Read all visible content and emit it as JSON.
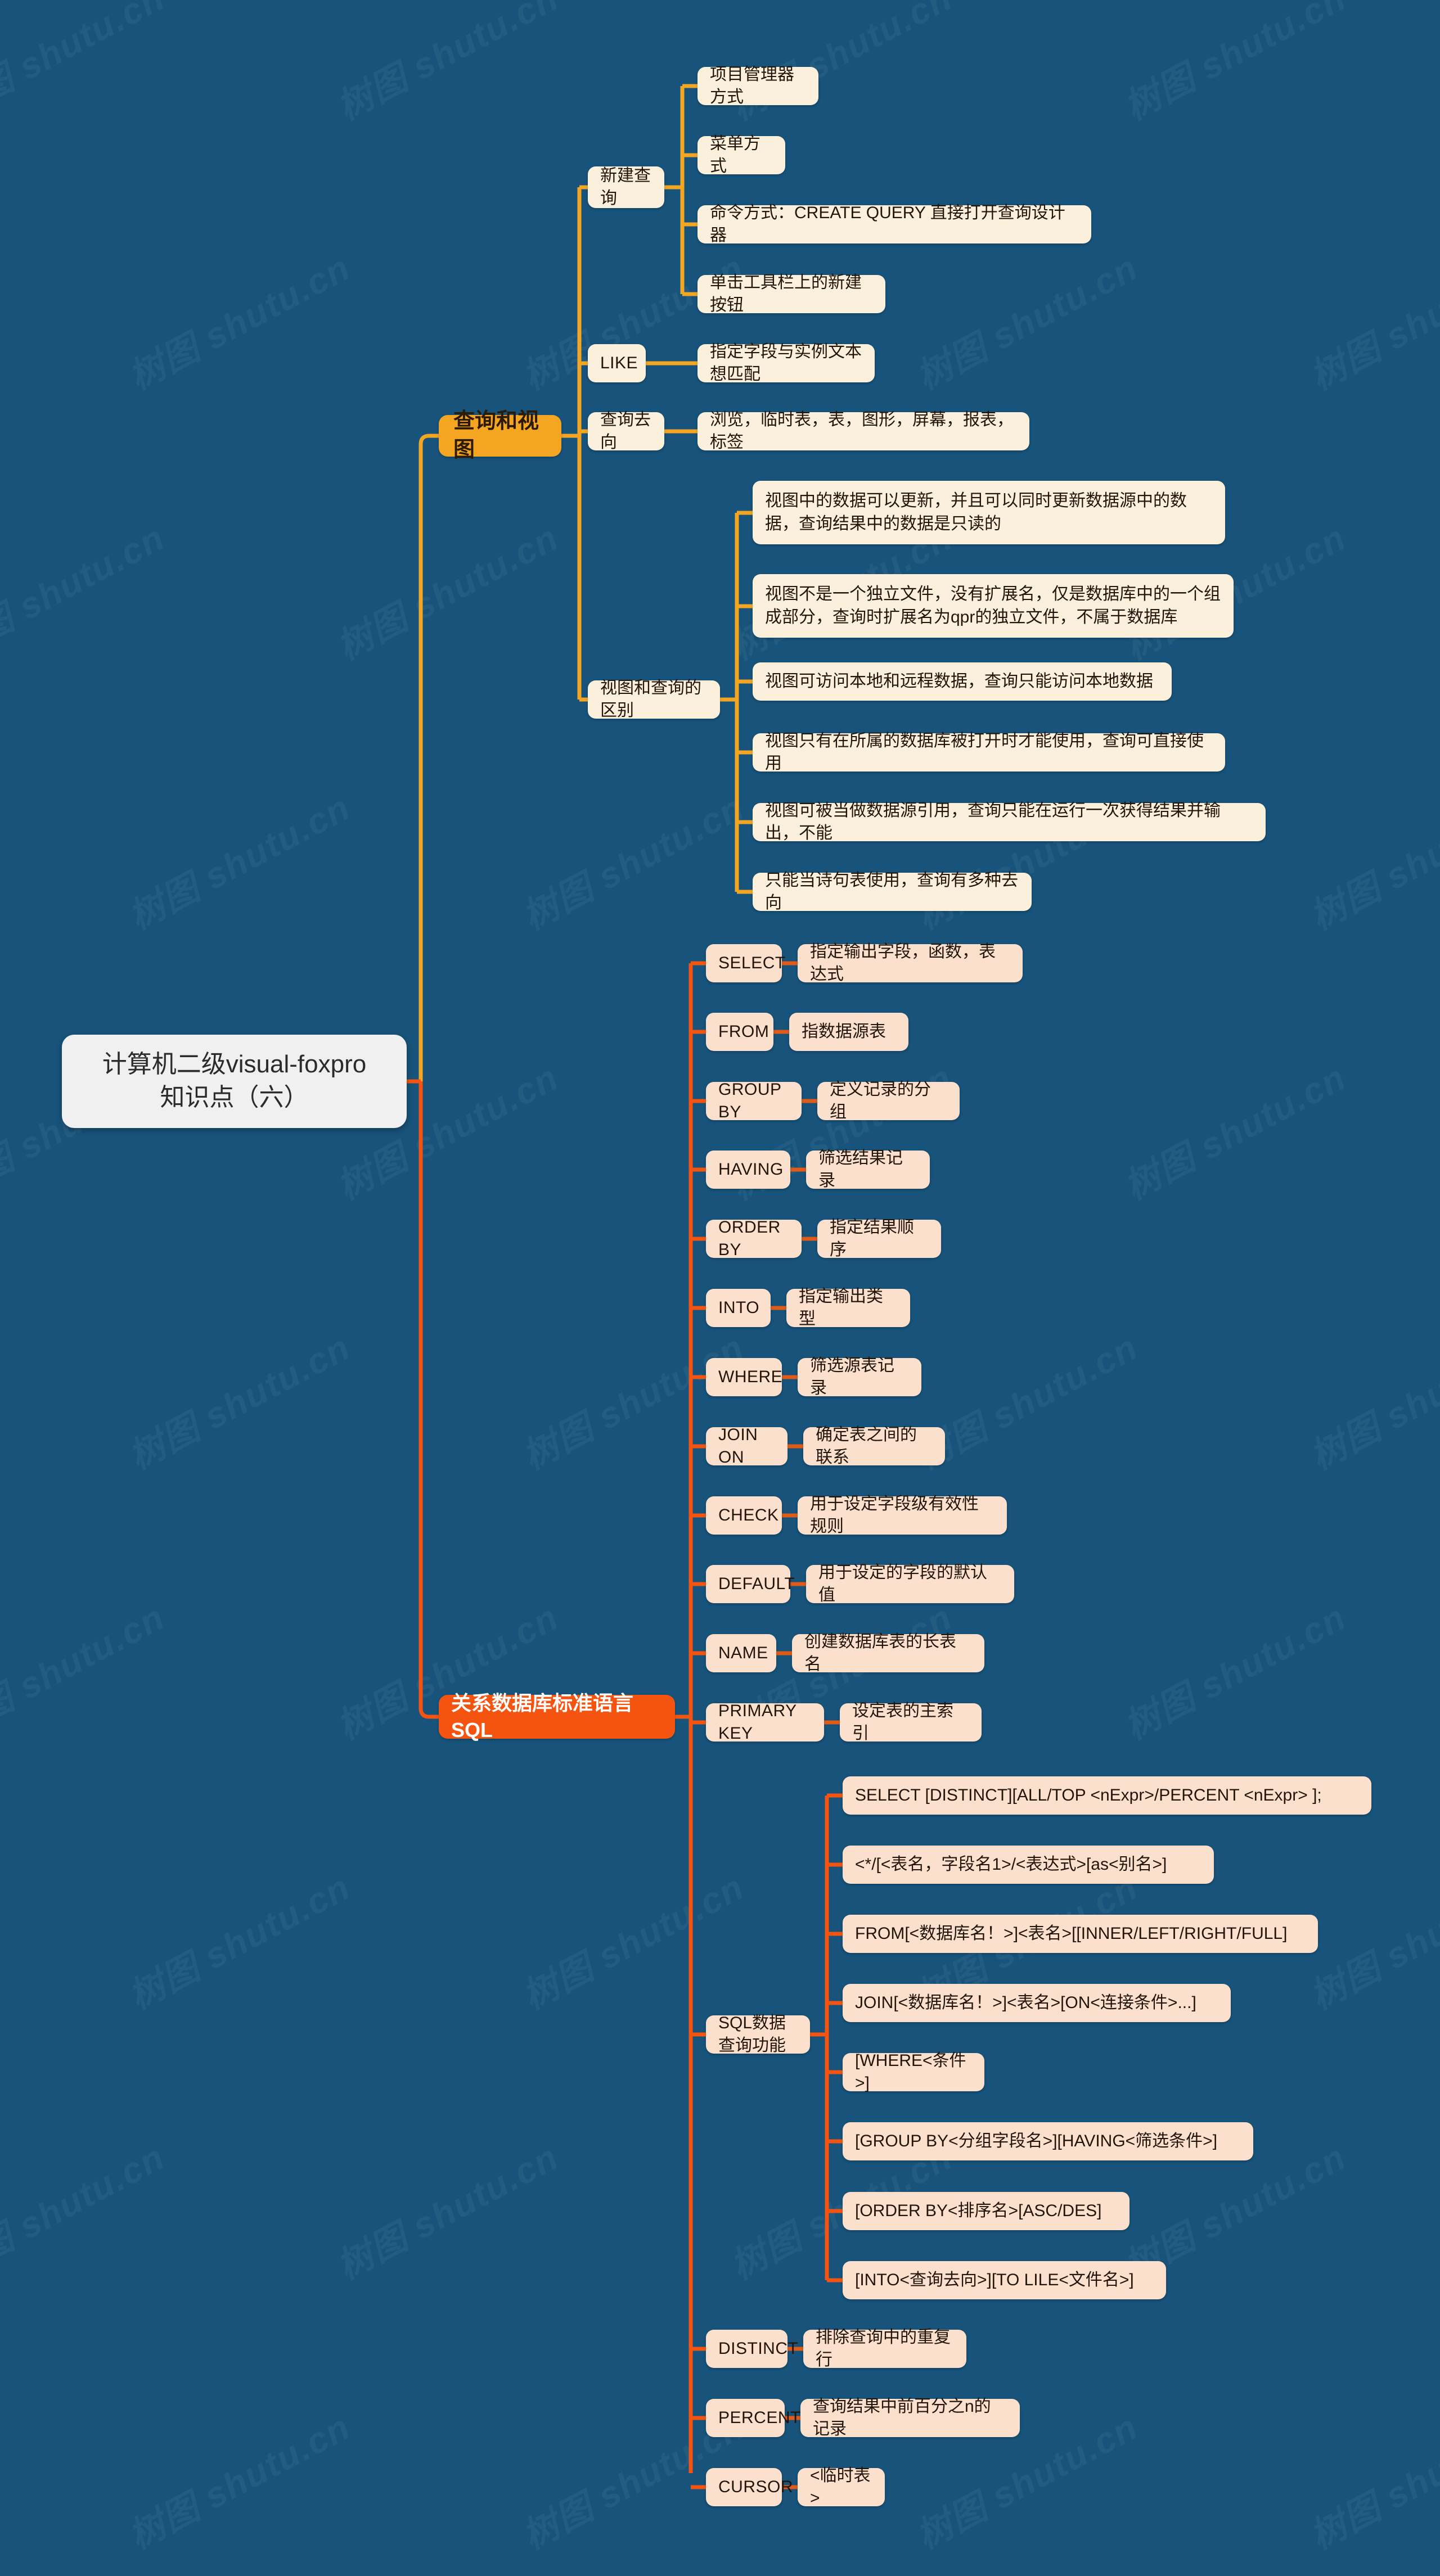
{
  "meta": {
    "title": "计算机二级visual-foxpro知识点（六）",
    "background_color": "#17537a",
    "root_color": "#f0f0f0",
    "amber_color": "#f4a521",
    "orange_color": "#f4540f",
    "cream_color": "#fbf0dc",
    "peach_color": "#fbe0ce",
    "watermark_text": "树图 shutu.cn"
  },
  "root": {
    "label": "计算机二级visual-foxpro\n知识点（六）"
  },
  "branches": [
    {
      "id": "query-and-view",
      "label": "查询和视图",
      "color": "#f4a521",
      "children": [
        {
          "label": "新建查询",
          "children": [
            {
              "label": "项目管理器方式"
            },
            {
              "label": "菜单方式"
            },
            {
              "label": "命令方式：CREATE QUERY 直接打开查询设计器"
            },
            {
              "label": "单击工具栏上的新建按钮"
            }
          ]
        },
        {
          "label": "LIKE",
          "children": [
            {
              "label": "指定字段与实例文本想匹配"
            }
          ]
        },
        {
          "label": "查询去向",
          "children": [
            {
              "label": "浏览，临时表，表，图形，屏幕，报表，标签"
            }
          ]
        },
        {
          "label": "视图和查询的区别",
          "children": [
            {
              "label": "视图中的数据可以更新，并且可以同时更新数据源中的数据，查询结果中的数据是只读的"
            },
            {
              "label": "视图不是一个独立文件，没有扩展名，仅是数据库中的一个组成部分，查询时扩展名为qpr的独立文件，不属于数据库"
            },
            {
              "label": "视图可访问本地和远程数据，查询只能访问本地数据"
            },
            {
              "label": "视图只有在所属的数据库被打开时才能使用，查询可直接使用"
            },
            {
              "label": "视图可被当做数据源引用，查询只能在运行一次获得结果并输出，不能"
            },
            {
              "label": "只能当诗句表使用，查询有多种去向"
            }
          ]
        }
      ]
    },
    {
      "id": "sql",
      "label": "关系数据库标准语言SQL",
      "color": "#f4540f",
      "children": [
        {
          "label": "SELECT",
          "children": [
            {
              "label": "指定输出字段，函数，表达式"
            }
          ]
        },
        {
          "label": "FROM",
          "children": [
            {
              "label": "指数据源表"
            }
          ]
        },
        {
          "label": "GROUP BY",
          "children": [
            {
              "label": "定义记录的分组"
            }
          ]
        },
        {
          "label": "HAVING",
          "children": [
            {
              "label": "筛选结果记录"
            }
          ]
        },
        {
          "label": "ORDER  BY",
          "children": [
            {
              "label": "指定结果顺序"
            }
          ]
        },
        {
          "label": "INTO",
          "children": [
            {
              "label": "指定输出类型"
            }
          ]
        },
        {
          "label": "WHERE",
          "children": [
            {
              "label": "筛选源表记录"
            }
          ]
        },
        {
          "label": "JOIN ON",
          "children": [
            {
              "label": "确定表之间的联系"
            }
          ]
        },
        {
          "label": "CHECK",
          "children": [
            {
              "label": "用于设定字段级有效性规则"
            }
          ]
        },
        {
          "label": "DEFAULT",
          "children": [
            {
              "label": "用于设定的字段的默认值"
            }
          ]
        },
        {
          "label": "NAME",
          "children": [
            {
              "label": "创建数据库表的长表名"
            }
          ]
        },
        {
          "label": "PRIMARY KEY",
          "children": [
            {
              "label": "设定表的主索引"
            }
          ]
        },
        {
          "label": "SQL数据查询功能",
          "children": [
            {
              "label": "SELECT [DISTINCT][ALL/TOP <nExpr>/PERCENT <nExpr> ];"
            },
            {
              "label": "<*/[<表名，字段名1>/<表达式>[as<别名>]"
            },
            {
              "label": "FROM[<数据库名！>]<表名>[[INNER/LEFT/RIGHT/FULL]"
            },
            {
              "label": "JOIN[<数据库名！>]<表名>[ON<连接条件>...]"
            },
            {
              "label": "[WHERE<条件>]"
            },
            {
              "label": "[GROUP BY<分组字段名>][HAVING<筛选条件>]"
            },
            {
              "label": "[ORDER BY<排序名>[ASC/DES]"
            },
            {
              "label": "[INTO<查询去向>][TO LILE<文件名>]"
            }
          ]
        },
        {
          "label": "DISTINCT",
          "children": [
            {
              "label": "排除查询中的重复行"
            }
          ]
        },
        {
          "label": "PERCENT",
          "children": [
            {
              "label": "查询结果中前百分之n的记录"
            }
          ]
        },
        {
          "label": "CURSOR",
          "children": [
            {
              "label": "<临时表>"
            }
          ]
        }
      ]
    }
  ]
}
